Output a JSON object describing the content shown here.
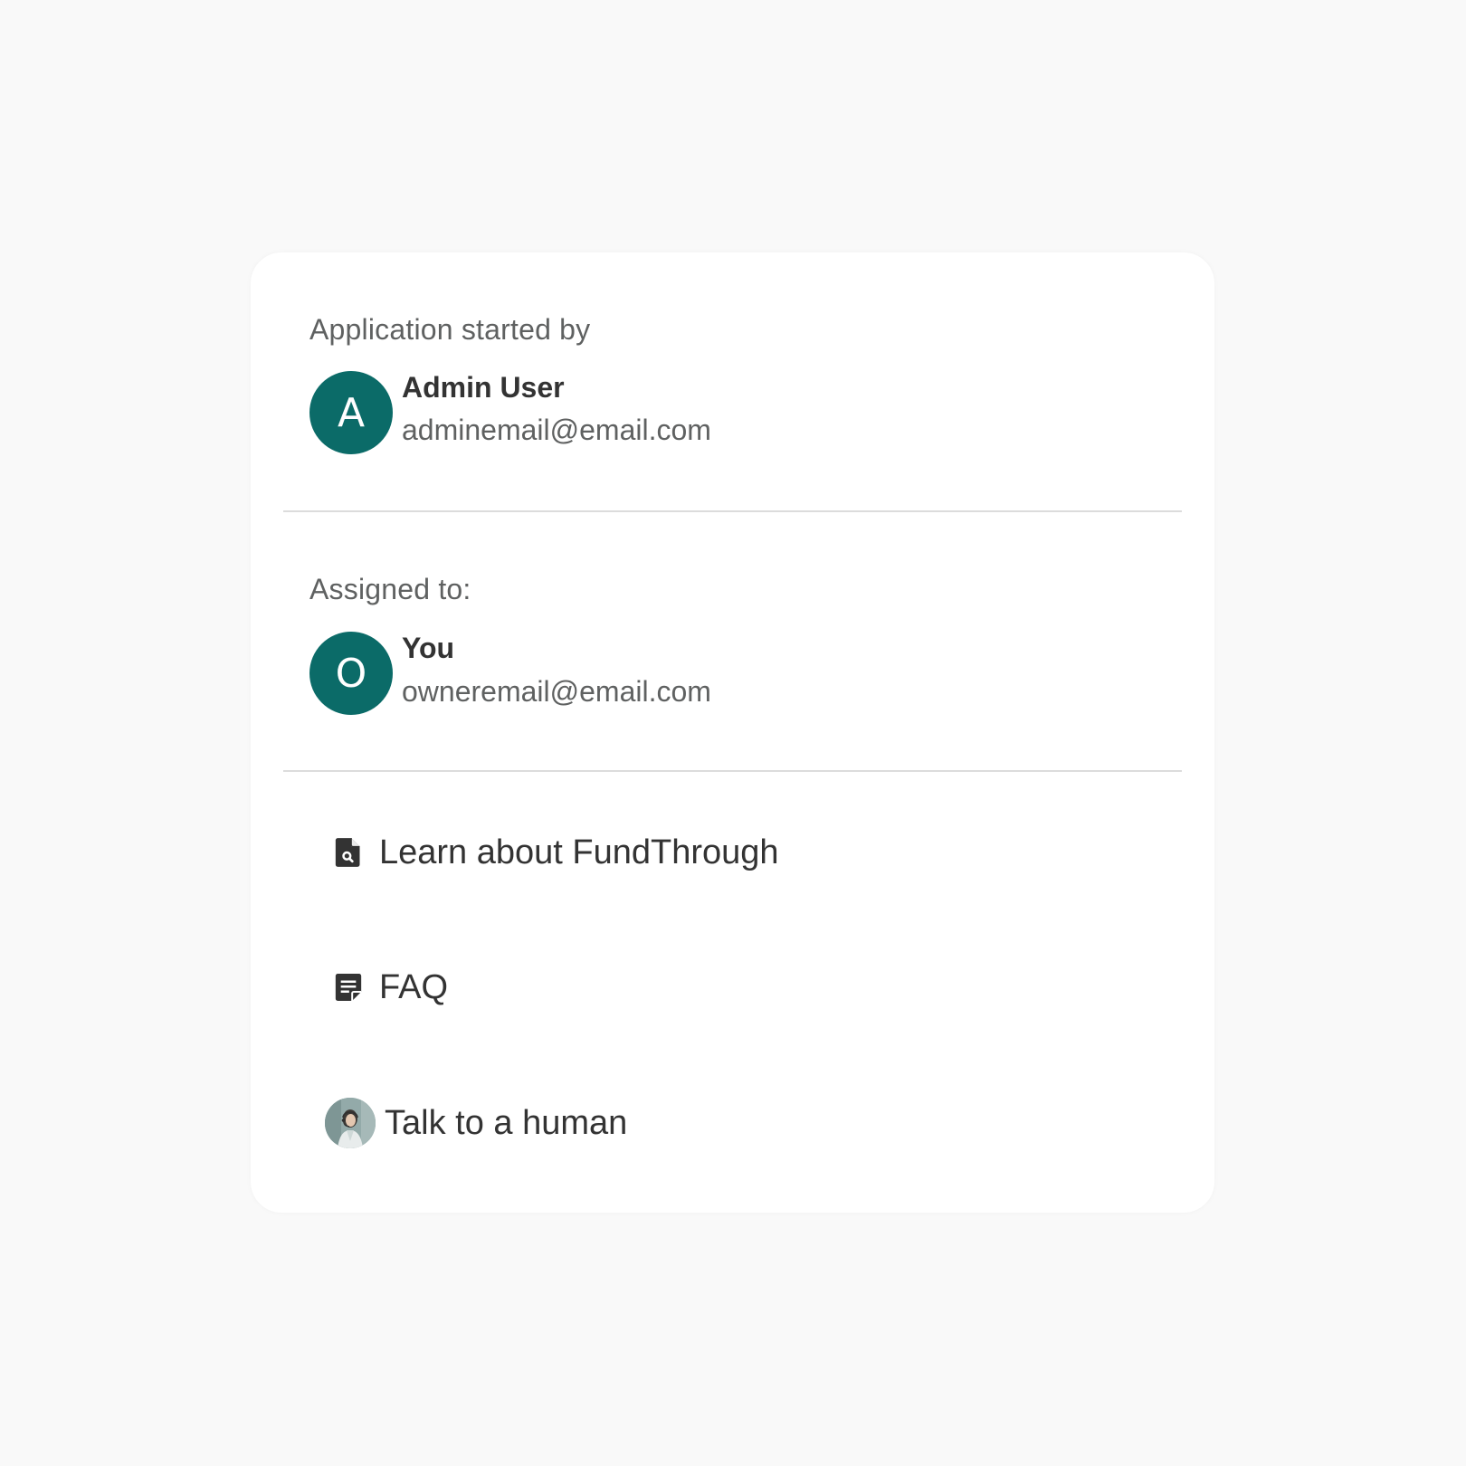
{
  "started_by": {
    "label": "Application started by",
    "avatar_initial": "A",
    "name": "Admin User",
    "email": "adminemail@email.com"
  },
  "assigned_to": {
    "label": "Assigned to:",
    "avatar_initial": "O",
    "name": "You",
    "email": "owneremail@email.com"
  },
  "links": [
    {
      "label": "Learn about FundThrough",
      "icon": "document-search-icon"
    },
    {
      "label": "FAQ",
      "icon": "note-icon"
    },
    {
      "label": "Talk to a human",
      "icon": "support-agent-photo"
    }
  ],
  "colors": {
    "avatar_bg": "#0b6b68",
    "text_primary": "#333333",
    "text_secondary": "#5f6161",
    "page_bg": "#f9f9f9",
    "card_bg": "#ffffff"
  }
}
